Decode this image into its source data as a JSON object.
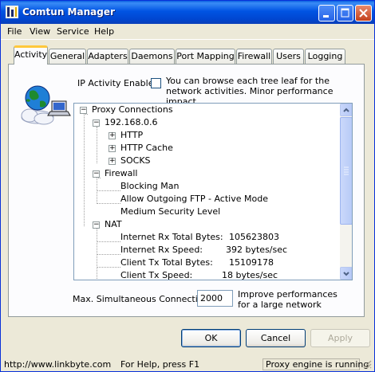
{
  "window": {
    "title": "Comtun Manager"
  },
  "menu": [
    "File",
    "View",
    "Service",
    "Help"
  ],
  "tabs": [
    "Activity",
    "General",
    "Adapters",
    "Daemons",
    "Port Mapping",
    "Firewall",
    "Users",
    "Logging"
  ],
  "activity": {
    "ip_enable_label": "IP Activity Enable:",
    "ip_enable_checked": false,
    "ip_enable_note": "You can browse each tree leaf for the network activities. Minor performance impact.",
    "tree": {
      "root": "Proxy Connections",
      "ip": "192.168.0.6",
      "ip_children": [
        "HTTP",
        "HTTP Cache",
        "SOCKS"
      ],
      "firewall": "Firewall",
      "firewall_children": [
        "Blocking Man",
        "Allow Outgoing FTP - Active Mode",
        "Medium Security Level"
      ],
      "nat": "NAT",
      "nat_stats": [
        {
          "label": "Internet Rx Total Bytes:",
          "value": "105623803"
        },
        {
          "label": "Internet Rx Speed:",
          "value": "392 bytes/sec"
        },
        {
          "label": "Client Tx Total Bytes:",
          "value": "15109178"
        },
        {
          "label": "Client Tx Speed:",
          "value": "18 bytes/sec"
        }
      ]
    },
    "max_connections_label": "Max. Simultaneous Connections:",
    "max_connections_value": "2000",
    "max_connections_note": "Improve performances for a large network"
  },
  "buttons": {
    "ok": "OK",
    "cancel": "Cancel",
    "apply": "Apply"
  },
  "status": {
    "url": "http://www.linkbyte.com",
    "help": "For Help, press F1",
    "engine": "Proxy engine is running"
  },
  "colors": {
    "titlebar": "#0054e3",
    "face": "#ece9d8",
    "active_tab_accent": "#ffc83c"
  }
}
